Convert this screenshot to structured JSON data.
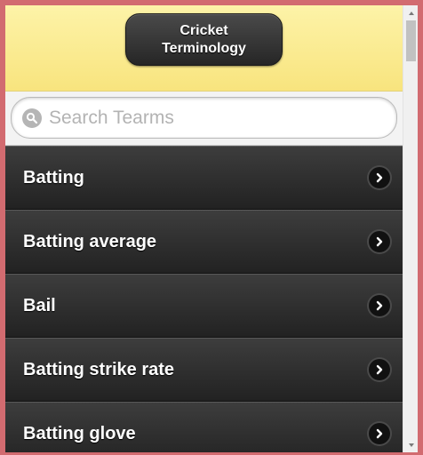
{
  "header": {
    "title": "Cricket\nTerminology"
  },
  "search": {
    "placeholder": "Search Tearms",
    "value": ""
  },
  "list": {
    "items": [
      {
        "label": "Batting"
      },
      {
        "label": "Batting average"
      },
      {
        "label": "Bail"
      },
      {
        "label": "Batting strike rate"
      },
      {
        "label": "Batting glove"
      }
    ]
  },
  "icons": {
    "search": "search-icon",
    "item_arrow": "chevron-right-icon",
    "scroll_up": "scroll-up-arrow-icon",
    "scroll_down": "scroll-down-arrow-icon"
  },
  "colors": {
    "header_bg": "#f8e47e",
    "list_bg": "#2e2e2e",
    "window_border": "#d26b70"
  }
}
